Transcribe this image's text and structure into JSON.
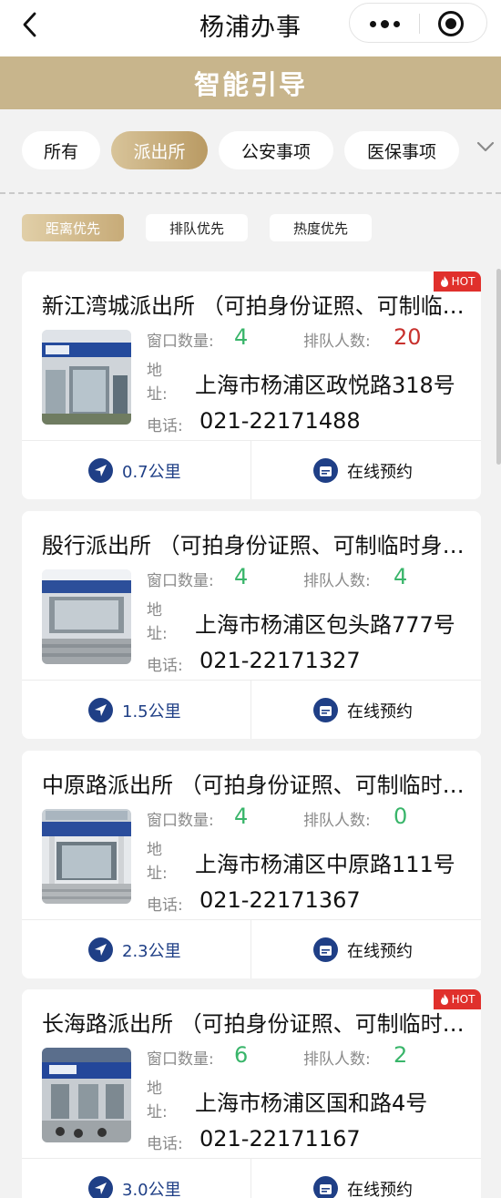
{
  "nav": {
    "title": "杨浦办事",
    "back_icon": "chevron-left-icon",
    "more_icon": "more-dots-icon",
    "close_icon": "close-target-icon"
  },
  "banner": {
    "title": "智能引导"
  },
  "categories": [
    {
      "label": "所有",
      "active": false
    },
    {
      "label": "派出所",
      "active": true
    },
    {
      "label": "公安事项",
      "active": false
    },
    {
      "label": "医保事项",
      "active": false
    }
  ],
  "sort_options": [
    {
      "label": "距离优先",
      "active": true
    },
    {
      "label": "排队优先",
      "active": false
    },
    {
      "label": "热度优先",
      "active": false
    }
  ],
  "labels": {
    "windows": "窗口数量:",
    "queue": "排队人数:",
    "address_1": "地",
    "address_2": "址:",
    "phone": "电话:",
    "book": "在线预约",
    "hot": "HOT"
  },
  "stations": [
    {
      "name": "新江湾城派出所 （可拍身份证照、可制临时身份证）",
      "windows": "4",
      "queue": "20",
      "queue_color": "#c8312d",
      "address": "上海市杨浦区政悦路318号",
      "phone": "021-22171488",
      "distance": "0.7公里",
      "hot": true
    },
    {
      "name": "殷行派出所 （可拍身份证照、可制临时身份证）",
      "windows": "4",
      "queue": "4",
      "queue_color": "#39b56a",
      "address": "上海市杨浦区包头路777号",
      "phone": "021-22171327",
      "distance": "1.5公里",
      "hot": false
    },
    {
      "name": "中原路派出所 （可拍身份证照、可制临时身份证）",
      "windows": "4",
      "queue": "0",
      "queue_color": "#39b56a",
      "address": "上海市杨浦区中原路111号",
      "phone": "021-22171367",
      "distance": "2.3公里",
      "hot": false
    },
    {
      "name": "长海路派出所 （可拍身份证照、可制临时身份证）",
      "windows": "6",
      "queue": "2",
      "queue_color": "#39b56a",
      "address": "上海市杨浦区国和路4号",
      "phone": "021-22171167",
      "distance": "3.0公里",
      "hot": true
    }
  ],
  "colors": {
    "accent_gold": "#c8b58c",
    "navy": "#1f3f86",
    "green": "#39b56a",
    "red": "#c8312d",
    "hot": "#e0302c"
  }
}
